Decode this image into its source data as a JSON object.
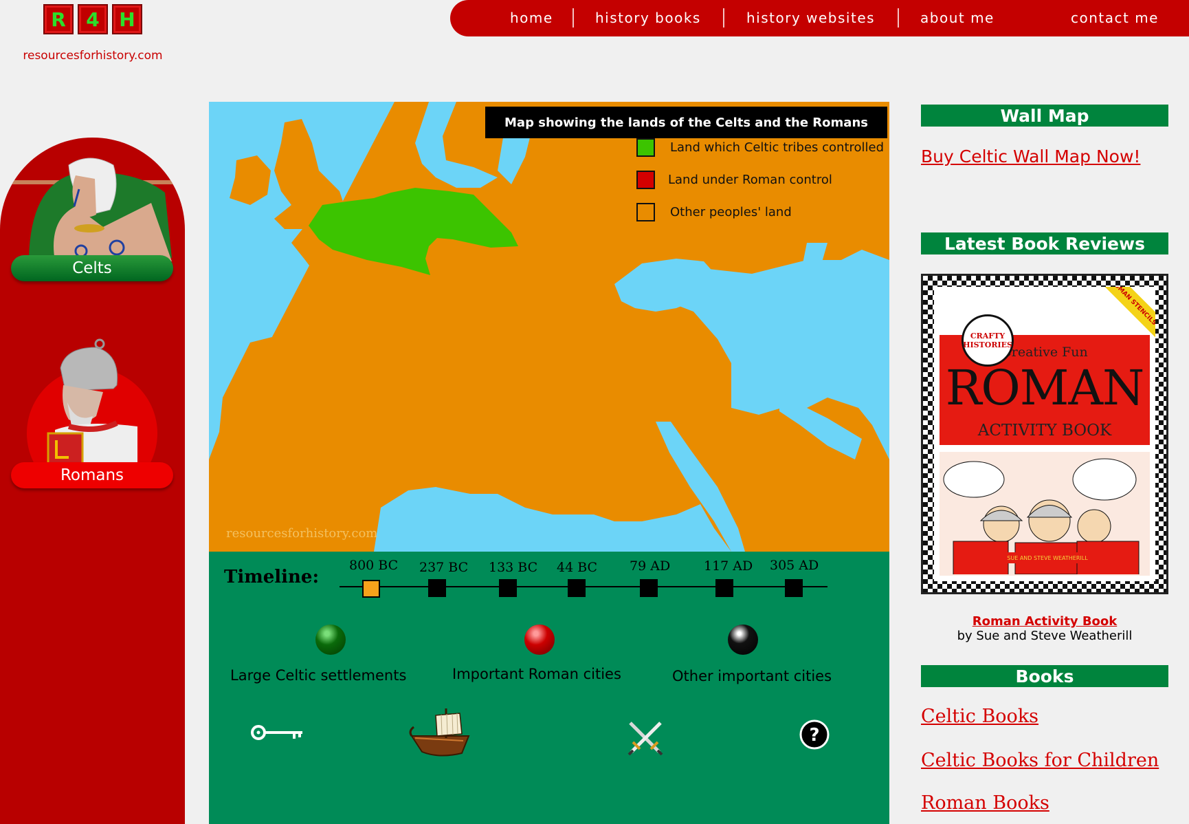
{
  "header": {
    "logo_letters": [
      "R",
      "4",
      "H"
    ],
    "site_url": "resourcesforhistory.com",
    "nav": [
      "home",
      "history books",
      "history websites",
      "about me",
      "contact me"
    ]
  },
  "sidebar": {
    "items": [
      {
        "label": "Celts",
        "color": "#007a2c"
      },
      {
        "label": "Romans",
        "color": "#ee0000"
      }
    ]
  },
  "map": {
    "title": "Map showing the lands of the Celts and the Romans",
    "legend": [
      {
        "label": "Land which Celtic tribes controlled",
        "color": "#3cc400"
      },
      {
        "label": "Land under Roman control",
        "color": "#d40000"
      },
      {
        "label": "Other peoples' land",
        "color": "#e98c00"
      }
    ],
    "watermark": "resourcesforhistory.com",
    "sea_color": "#6cd4f7"
  },
  "timeline": {
    "label": "Timeline:",
    "stops": [
      "800 BC",
      "237 BC",
      "133 BC",
      "44 BC",
      "79 AD",
      "117 AD",
      "305 AD"
    ],
    "selected_index": 0
  },
  "key": [
    {
      "label": "Large Celtic settlements",
      "color": "#0a6a0a"
    },
    {
      "label": "Important Roman cities",
      "color": "#cc0000"
    },
    {
      "label": "Other important cities",
      "color": "#000000"
    }
  ],
  "tools": [
    "key-icon",
    "ship-icon",
    "crossed-swords-icon",
    "help-icon"
  ],
  "right": {
    "wall_map_heading": "Wall Map",
    "wall_map_link": "Buy Celtic Wall Map Now!",
    "reviews_heading": "Latest Book Reviews",
    "book": {
      "title": "Roman Activity Book",
      "author": "by Sue and Steve Weatherill"
    },
    "books_heading": "Books",
    "books_links": [
      "Celtic Books",
      "Celtic Books for Children",
      "Roman Books"
    ]
  }
}
